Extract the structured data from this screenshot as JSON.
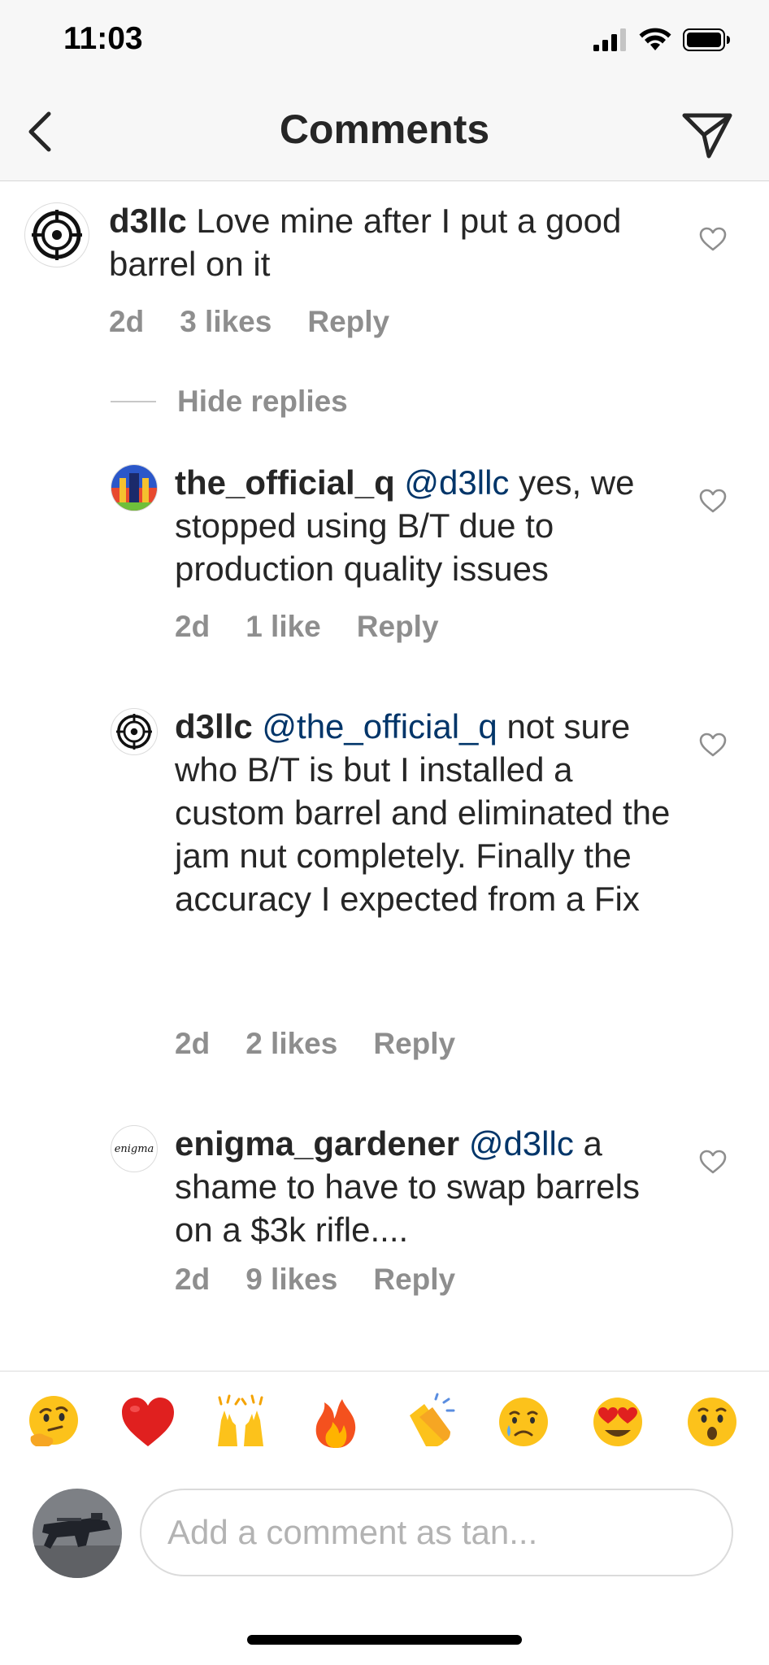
{
  "status_bar": {
    "time": "11:03"
  },
  "header": {
    "title": "Comments"
  },
  "comments": [
    {
      "username": "d3llc",
      "mention": "",
      "text": "Love mine after I put a good barrel on it",
      "time": "2d",
      "likes": "3 likes",
      "reply_label": "Reply",
      "avatar_icon": "crosshair-logo"
    },
    {
      "username": "the_official_q",
      "mention": "@d3llc",
      "text": "yes, we stopped using B/T due to production quality issues",
      "time": "2d",
      "likes": "1 like",
      "reply_label": "Reply",
      "avatar_icon": "colorful-avatar"
    },
    {
      "username": "d3llc",
      "mention": "@the_official_q",
      "text": "not sure who B/T is but I installed a custom barrel and eliminated the jam nut completely.  Finally the accuracy I expected from a Fix",
      "time": "2d",
      "likes": "2 likes",
      "reply_label": "Reply",
      "avatar_icon": "crosshair-logo"
    },
    {
      "username": "enigma_gardener",
      "mention": "@d3llc",
      "text": "a shame to have to swap barrels on a $3k rifle....",
      "time": "2d",
      "likes": "9 likes",
      "reply_label": "Reply",
      "avatar_logo_text": "enigma"
    }
  ],
  "hide_replies_label": "Hide replies",
  "emoji_bar": [
    "🤔",
    "❤️",
    "🙌",
    "🔥",
    "👏",
    "😢",
    "😍",
    "😮"
  ],
  "composer": {
    "placeholder": "Add a comment as tan..."
  },
  "colors": {
    "mention": "#003569",
    "secondary_text": "#8e8e8e",
    "bar_background": "#f7f7f7"
  }
}
